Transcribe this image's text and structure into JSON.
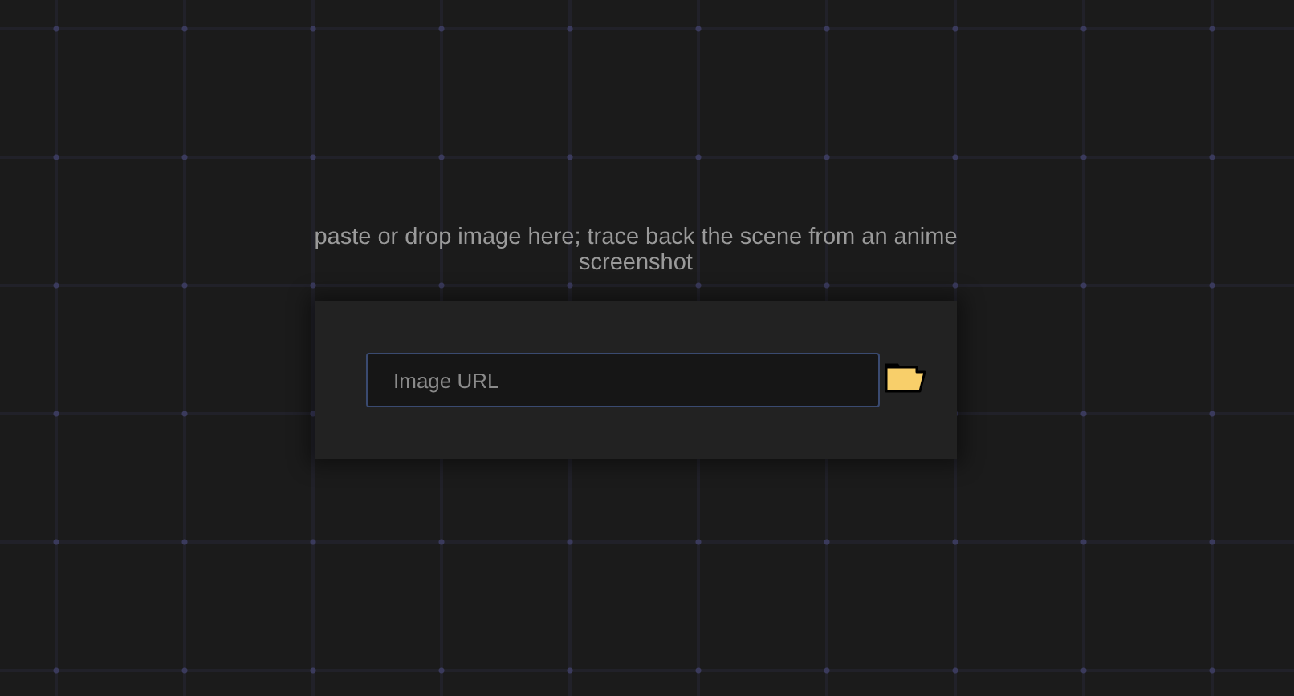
{
  "tagline": "paste or drop image here; trace back the scene from an anime screenshot",
  "search": {
    "placeholder": "Image URL"
  }
}
